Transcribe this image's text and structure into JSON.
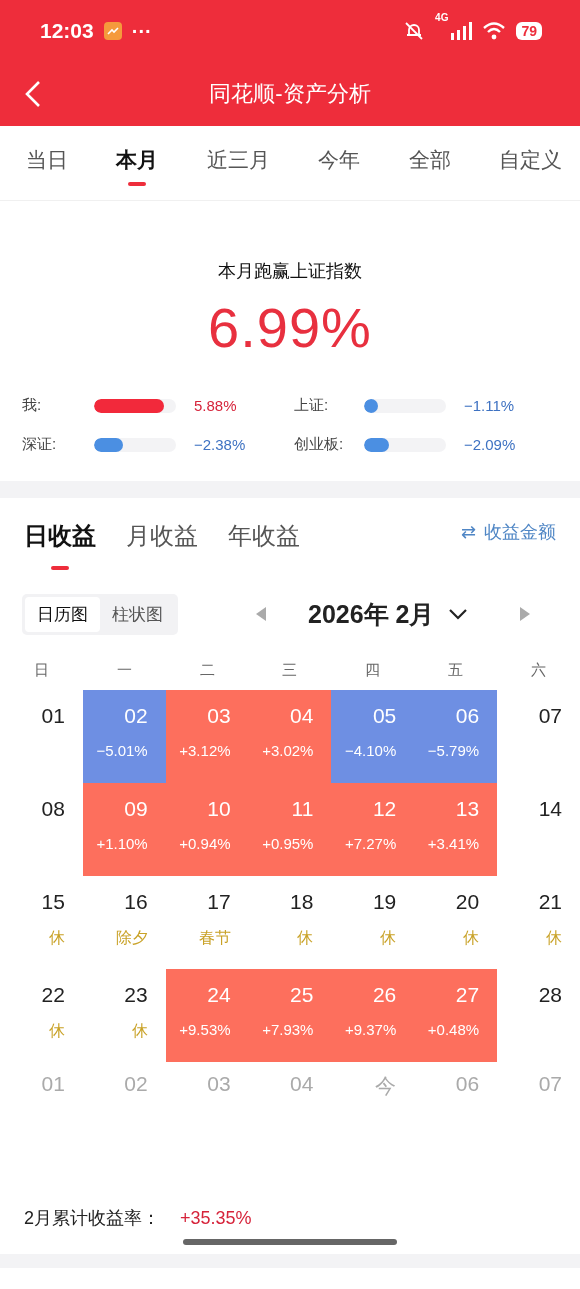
{
  "status_bar": {
    "time": "12:03",
    "more": "···",
    "network": "4G",
    "battery": "79"
  },
  "nav": {
    "title": "同花顺-资产分析"
  },
  "period_tabs": [
    {
      "label": "当日",
      "selected": false
    },
    {
      "label": "本月",
      "selected": true
    },
    {
      "label": "近三月",
      "selected": false
    },
    {
      "label": "今年",
      "selected": false
    },
    {
      "label": "全部",
      "selected": false
    },
    {
      "label": "自定义",
      "selected": false
    }
  ],
  "summary": {
    "headline": "本月跑赢上证指数",
    "value": "6.99%",
    "comparisons": [
      {
        "label": "我:",
        "kind": "up",
        "level": 0.85,
        "reading": "5.88%"
      },
      {
        "label": "上证:",
        "kind": "down",
        "level": 0.12,
        "reading": "−1.11%"
      },
      {
        "label": "深证:",
        "kind": "down",
        "level": 0.35,
        "reading": "−2.38%"
      },
      {
        "label": "创业板:",
        "kind": "down",
        "level": 0.31,
        "reading": "−2.09%"
      }
    ]
  },
  "return_tabs": [
    {
      "label": "日收益",
      "selected": true
    },
    {
      "label": "月收益",
      "selected": false
    },
    {
      "label": "年收益",
      "selected": false
    }
  ],
  "amount_toggle": {
    "icon": "⇄",
    "label": "收益金额"
  },
  "view_switch": [
    {
      "label": "日历图",
      "selected": true
    },
    {
      "label": "柱状图",
      "selected": false
    }
  ],
  "month_picker": {
    "label": "2026年 2月"
  },
  "weekdays": [
    "日",
    "一",
    "二",
    "三",
    "四",
    "五",
    "六"
  ],
  "weeks": [
    [
      {
        "day": "01",
        "kind": "plain"
      },
      {
        "day": "02",
        "kind": "down",
        "change": "−5.01%"
      },
      {
        "day": "03",
        "kind": "up",
        "change": "+3.12%"
      },
      {
        "day": "04",
        "kind": "up",
        "change": "+3.02%"
      },
      {
        "day": "05",
        "kind": "down",
        "change": "−4.10%"
      },
      {
        "day": "06",
        "kind": "down",
        "change": "−5.79%"
      },
      {
        "day": "07",
        "kind": "plain"
      }
    ],
    [
      {
        "day": "08",
        "kind": "plain"
      },
      {
        "day": "09",
        "kind": "up",
        "change": "+1.10%"
      },
      {
        "day": "10",
        "kind": "up",
        "change": "+0.94%"
      },
      {
        "day": "11",
        "kind": "up",
        "change": "+0.95%"
      },
      {
        "day": "12",
        "kind": "up",
        "change": "+7.27%"
      },
      {
        "day": "13",
        "kind": "up",
        "change": "+3.41%"
      },
      {
        "day": "14",
        "kind": "plain"
      }
    ],
    [
      {
        "day": "15",
        "kind": "holiday",
        "note": "休"
      },
      {
        "day": "16",
        "kind": "holiday",
        "note": "除夕"
      },
      {
        "day": "17",
        "kind": "holiday",
        "note": "春节"
      },
      {
        "day": "18",
        "kind": "holiday",
        "note": "休"
      },
      {
        "day": "19",
        "kind": "holiday",
        "note": "休"
      },
      {
        "day": "20",
        "kind": "holiday",
        "note": "休"
      },
      {
        "day": "21",
        "kind": "holiday",
        "note": "休"
      }
    ],
    [
      {
        "day": "22",
        "kind": "holiday",
        "note": "休"
      },
      {
        "day": "23",
        "kind": "holiday",
        "note": "休"
      },
      {
        "day": "24",
        "kind": "up",
        "change": "+9.53%"
      },
      {
        "day": "25",
        "kind": "up",
        "change": "+7.93%"
      },
      {
        "day": "26",
        "kind": "up",
        "change": "+9.37%"
      },
      {
        "day": "27",
        "kind": "up",
        "change": "+0.48%"
      },
      {
        "day": "28",
        "kind": "plain"
      }
    ],
    [
      {
        "day": "01",
        "kind": "next"
      },
      {
        "day": "02",
        "kind": "next"
      },
      {
        "day": "03",
        "kind": "next"
      },
      {
        "day": "04",
        "kind": "next"
      },
      {
        "day": "今",
        "kind": "next"
      },
      {
        "day": "06",
        "kind": "next"
      },
      {
        "day": "07",
        "kind": "next"
      }
    ]
  ],
  "total": {
    "label": "2月累计收益率：",
    "value": "+35.35%"
  }
}
